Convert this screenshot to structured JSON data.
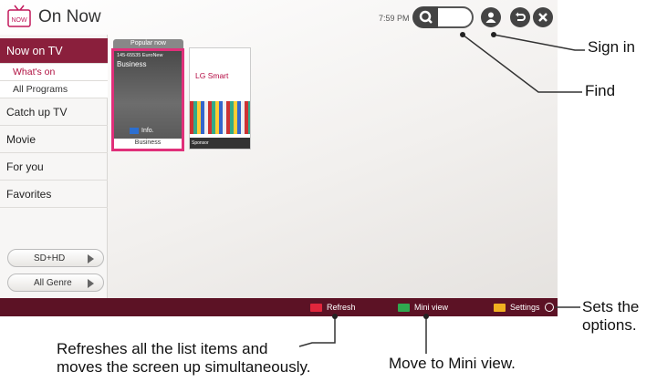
{
  "header": {
    "app_title": "On Now",
    "logo_text": "NOW",
    "clock": "7:59 PM"
  },
  "sidebar": {
    "items": [
      {
        "label": "Now on TV"
      },
      {
        "label": "What's on"
      },
      {
        "label": "All Programs"
      },
      {
        "label": "Catch up TV"
      },
      {
        "label": "Movie"
      },
      {
        "label": "For you"
      },
      {
        "label": "Favorites"
      }
    ],
    "filters": [
      {
        "label": "SD+HD"
      },
      {
        "label": "All Genre"
      }
    ]
  },
  "content": {
    "section_label": "Popular now",
    "cards": [
      {
        "channel": "145-65535 EuroNew",
        "program": "Business",
        "info_label": "Info.",
        "footer": "Business"
      },
      {
        "brand": "LG Smart",
        "footer": "Sponsor"
      }
    ]
  },
  "bottom_bar": {
    "refresh_label": "Refresh",
    "mini_view_label": "Mini view",
    "settings_label": "Settings"
  },
  "colors": {
    "accent": "#8a1f3c",
    "bottom_bar": "#5c1225",
    "highlight": "#e0307a",
    "refresh_key": "#e0263c",
    "mini_view_key": "#2fa84f",
    "settings_key": "#f0b020"
  },
  "icons": [
    "now-logo-icon",
    "search-icon",
    "user-icon",
    "back-icon",
    "close-icon",
    "arrow-right-icon"
  ],
  "annotations": {
    "signin": "Sign in",
    "find": "Find",
    "options_line1": "Sets the",
    "options_line2": "options.",
    "refresh_line1": "Refreshes all the list items and",
    "refresh_line2": "moves the screen up simultaneously.",
    "mini_view": "Move to Mini view."
  }
}
